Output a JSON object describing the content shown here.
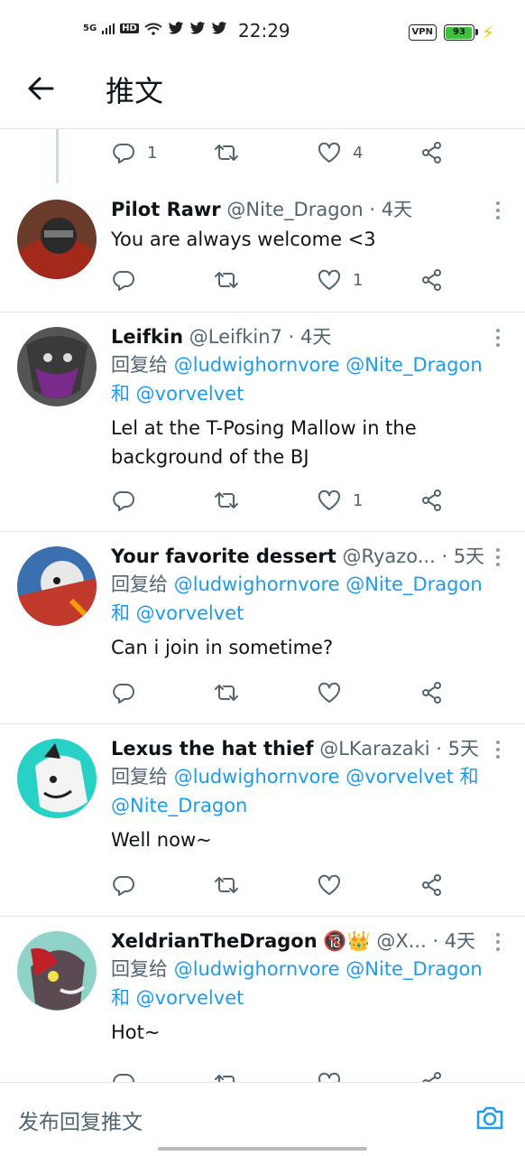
{
  "status_bar": {
    "network": "5G",
    "hd": "HD",
    "time": "22:29",
    "vpn": "VPN",
    "battery": "93"
  },
  "header": {
    "title": "推文"
  },
  "top_actions": {
    "reply_count": "1",
    "retweet_count": "",
    "like_count": "4"
  },
  "tweets": [
    {
      "name": "Pilot Rawr",
      "handle": "@Nite_Dragon",
      "time": "· 4天",
      "reply_prefix": "",
      "mentions": "",
      "mentions2": "",
      "text": "You are always welcome <3",
      "reply_count": "",
      "like_count": "1"
    },
    {
      "name": "Leifkin",
      "handle": "@Leifkin7",
      "time": "· 4天",
      "reply_prefix": "回复给",
      "mentions": "@ludwighornvore @Nite_Dragon",
      "mentions2": "和 @vorvelvet",
      "text": "Lel at the T-Posing Mallow in the background of the BJ",
      "reply_count": "",
      "like_count": "1"
    },
    {
      "name": "Your favorite dessert",
      "handle": "@Ryazo...",
      "time": "· 5天",
      "reply_prefix": "回复给",
      "mentions": "@ludwighornvore @Nite_Dragon",
      "mentions2": "和 @vorvelvet",
      "text": "Can i join in sometime?",
      "reply_count": "",
      "like_count": ""
    },
    {
      "name": "Lexus the hat thief",
      "handle": "@LKarazaki",
      "time": "· 5天",
      "reply_prefix": "回复给",
      "mentions": "@ludwighornvore @vorvelvet 和",
      "mentions2": "@Nite_Dragon",
      "text": "Well now~",
      "reply_count": "",
      "like_count": ""
    },
    {
      "name": "XeldrianTheDragon",
      "badges": "🔞👑",
      "handle": "@X...",
      "time": "· 4天",
      "reply_prefix": "回复给",
      "mentions": "@ludwighornvore @Nite_Dragon",
      "mentions2": "和 @vorvelvet",
      "text": "Hot~",
      "reply_count": "",
      "like_count": ""
    }
  ],
  "composer": {
    "placeholder": "发布回复推文"
  },
  "colors": {
    "accent": "#1d9bf0",
    "text_secondary": "#536471",
    "divider": "#e6e6e6"
  }
}
